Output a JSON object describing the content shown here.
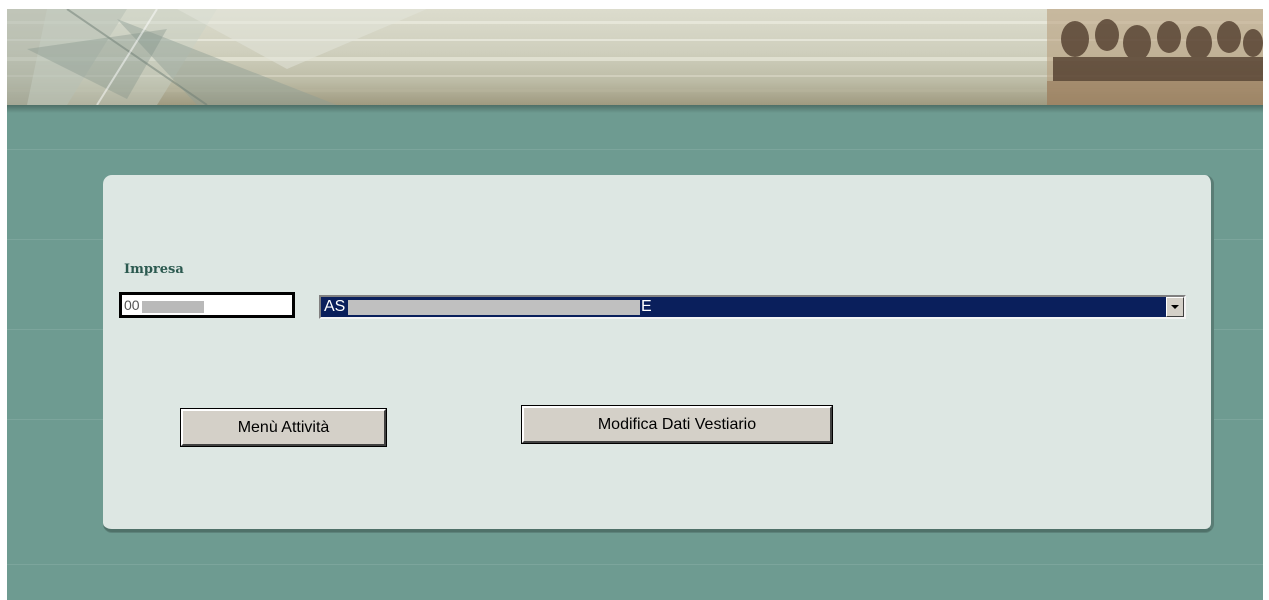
{
  "form": {
    "section_label": "Impresa",
    "code_field": {
      "value": "00"
    },
    "company_select": {
      "selected_prefix": "AS",
      "selected_suffix": "E"
    }
  },
  "actions": {
    "menu_label": "Menù Attività",
    "modifica_label": "Modifica Dati Vestiario"
  },
  "colors": {
    "background_teal": "#6e9b91",
    "panel": "#dde7e3",
    "label_text": "#2c5a50",
    "select_highlight": "#0a1f5c",
    "button_face": "#d4d0c8"
  },
  "icons": {
    "dropdown": "chevron-down-icon",
    "banner": "banner-image"
  }
}
